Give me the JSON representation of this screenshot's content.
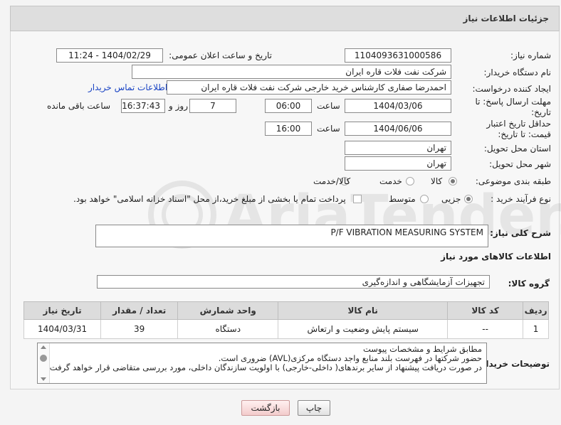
{
  "header": {
    "title": "جزئیات اطلاعات نیاز"
  },
  "form": {
    "need_number_label": "شماره نیاز:",
    "need_number": "1104093631000586",
    "announce_label": "تاریخ و ساعت اعلان عمومی:",
    "announce_value": "1404/02/29 - 11:24",
    "buyer_org_label": "نام دستگاه خریدار:",
    "buyer_org": "شرکت نفت فلات قاره ایران",
    "creator_label": "ایجاد کننده درخواست:",
    "creator": "احمدرضا صفاری کارشناس خرید خارجی شرکت نفت فلات قاره ایران",
    "contact_link": "اطلاعات تماس خریدار",
    "reply_deadline_label": "مهلت ارسال پاسخ: تا تاریخ:",
    "reply_date": "1404/03/06",
    "time_label": "ساعت",
    "reply_time": "06:00",
    "days_value": "7",
    "days_label": "روز و",
    "remaining_time": "16:37:43",
    "remaining_label": "ساعت باقی مانده",
    "validity_label": "حداقل تاریخ اعتبار قیمت: تا تاریخ:",
    "validity_date": "1404/06/06",
    "validity_time": "16:00",
    "province_label": "استان محل تحویل:",
    "province": "تهران",
    "city_label": "شهر محل تحویل:",
    "city": "تهران",
    "category_label": "طبقه بندی موضوعی:",
    "category_options": [
      "کالا",
      "خدمت",
      "کالا/خدمت"
    ],
    "category_selected": "کالا",
    "process_label": "نوع فرآیند خرید :",
    "process_options": [
      "جزیی",
      "متوسط"
    ],
    "process_selected": "جزیی",
    "payment_note": "پرداخت تمام یا بخشی از مبلغ خرید،از محل \"اسناد خزانه اسلامی\" خواهد بود."
  },
  "description": {
    "label": "شرح کلی نیاز:",
    "value": "P/F VIBRATION MEASURING SYSTEM"
  },
  "goods_info": {
    "section_title": "اطلاعات کالاهای مورد نیاز",
    "group_label": "گروه کالا:",
    "group_value": "تجهیزات آزمایشگاهی و اندازه‌گیری",
    "columns": [
      "ردیف",
      "کد کالا",
      "نام کالا",
      "واحد شمارش",
      "تعداد / مقدار",
      "تاریخ نیاز"
    ],
    "rows": [
      {
        "row": "1",
        "code": "--",
        "name": "سیستم پایش وضعیت و ارتعاش",
        "unit": "دستگاه",
        "qty": "39",
        "date": "1404/03/31"
      }
    ]
  },
  "buyer_notes": {
    "label": "توضیحات خریدار:",
    "lines": [
      "مطابق شرایط و  مشخصات پیوست",
      "حضور شرکتها در فهرست بلند منابع واجد دستگاه مرکزی(AVL) ضروری است.",
      "در صورت دریافت پیشنهاد از سایر برندهای( داخلی-خارجی) با اولویت سازندگان داخلی، مورد بررسی متقاضی قرار خواهد گرفت."
    ]
  },
  "buttons": {
    "print": "چاپ",
    "back": "بازگشت"
  },
  "watermark": {
    "text": "AriaTender.neT"
  },
  "colors": {
    "link": "#1a44c4",
    "back_button": "#f3cccc",
    "header_bg": "#dedede"
  }
}
